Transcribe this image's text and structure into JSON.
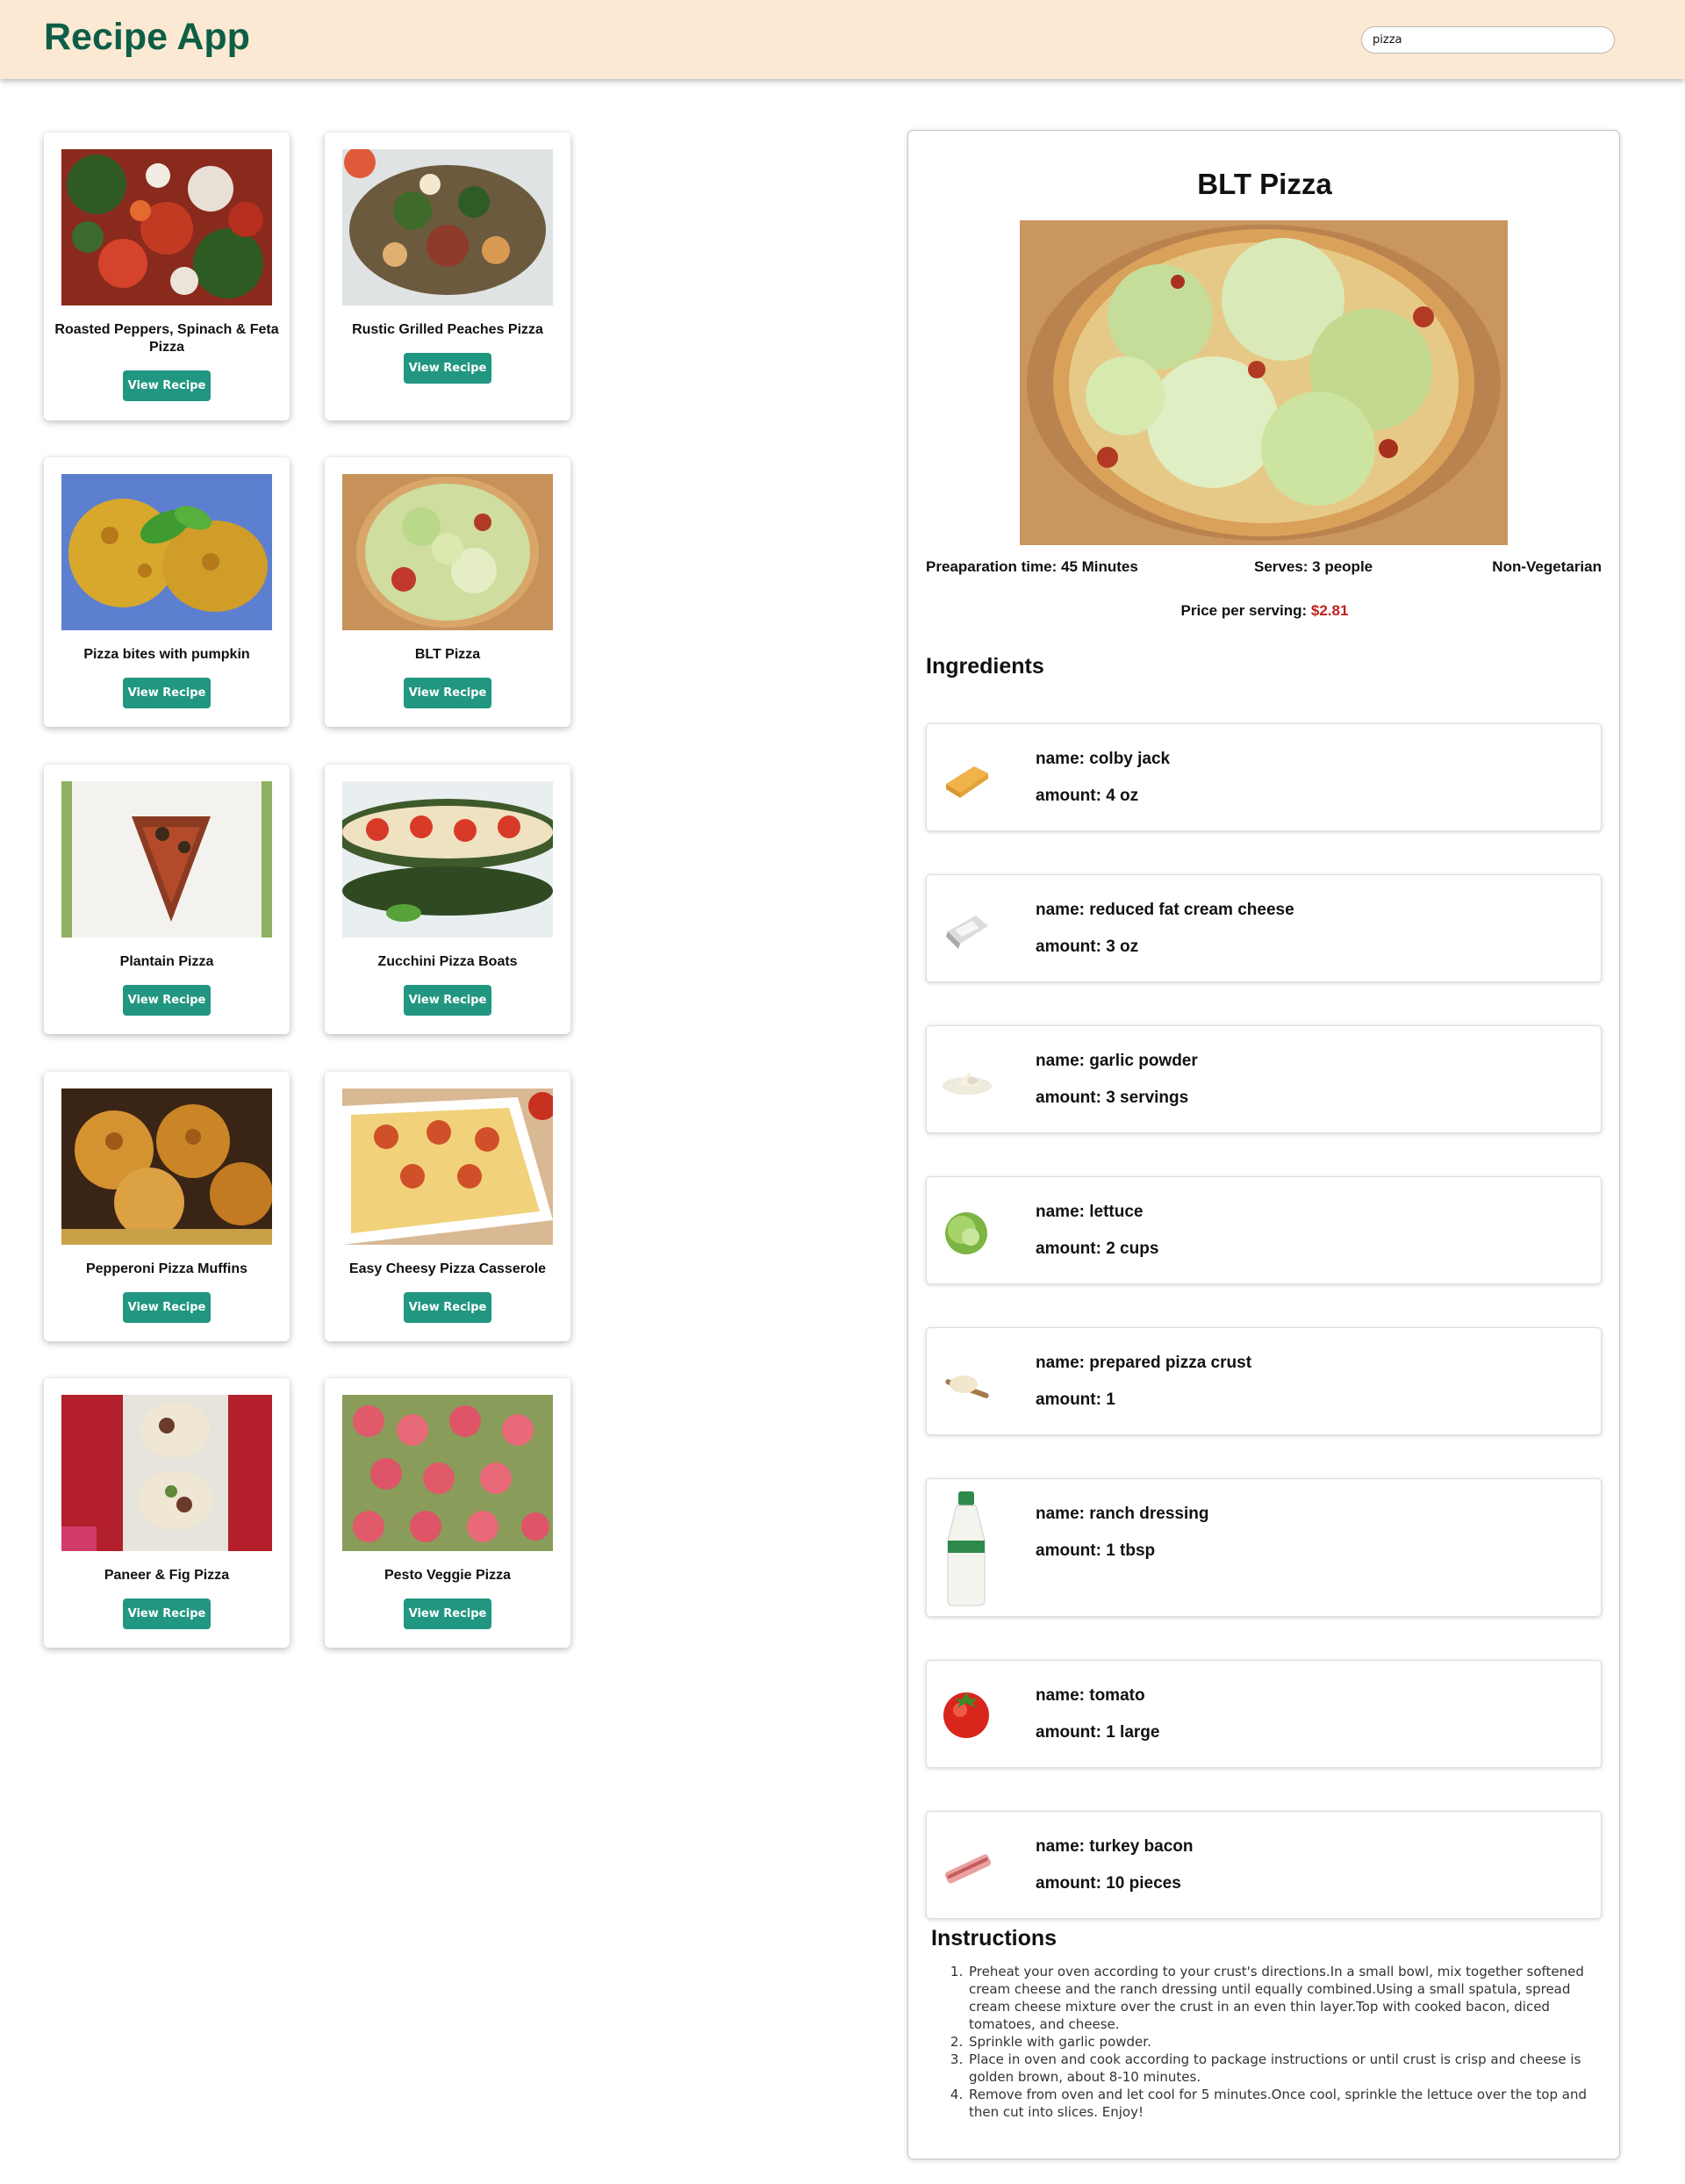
{
  "header": {
    "brand": "Recipe App",
    "search_value": "pizza"
  },
  "recipes": [
    {
      "title": "Roasted Peppers, Spinach & Feta Pizza",
      "button": "View Recipe"
    },
    {
      "title": "Rustic Grilled Peaches Pizza",
      "button": "View Recipe"
    },
    {
      "title": "Pizza bites with pumpkin",
      "button": "View Recipe"
    },
    {
      "title": "BLT Pizza",
      "button": "View Recipe"
    },
    {
      "title": "Plantain Pizza",
      "button": "View Recipe"
    },
    {
      "title": "Zucchini Pizza Boats",
      "button": "View Recipe"
    },
    {
      "title": "Pepperoni Pizza Muffins",
      "button": "View Recipe"
    },
    {
      "title": "Easy Cheesy Pizza Casserole",
      "button": "View Recipe"
    },
    {
      "title": "Paneer & Fig Pizza",
      "button": "View Recipe"
    },
    {
      "title": "Pesto Veggie Pizza",
      "button": "View Recipe"
    }
  ],
  "detail": {
    "title": "BLT Pizza",
    "prep_time": "Preaparation time: 45 Minutes",
    "serves": "Serves: 3 people",
    "diet": "Non-Vegetarian",
    "price_label": "Price per serving: ",
    "price_value": "$2.81",
    "ingredients_heading": "Ingredients",
    "ingredients": [
      {
        "name": "name: colby jack",
        "amount": "amount: 4 oz",
        "icon": "cheese-icon"
      },
      {
        "name": "name: reduced fat cream cheese",
        "amount": "amount: 3 oz",
        "icon": "cream-cheese-icon"
      },
      {
        "name": "name: garlic powder",
        "amount": "amount: 3 servings",
        "icon": "garlic-powder-icon"
      },
      {
        "name": "name: lettuce",
        "amount": "amount: 2 cups",
        "icon": "lettuce-icon"
      },
      {
        "name": "name: prepared pizza crust",
        "amount": "amount: 1",
        "icon": "dough-icon"
      },
      {
        "name": "name: ranch dressing",
        "amount": "amount: 1 tbsp",
        "icon": "dressing-bottle-icon"
      },
      {
        "name": "name: tomato",
        "amount": "amount: 1 large",
        "icon": "tomato-icon"
      },
      {
        "name": "name: turkey bacon",
        "amount": "amount: 10 pieces",
        "icon": "bacon-icon"
      }
    ],
    "instructions_heading": "Instructions",
    "instructions": [
      "Preheat your oven according to your crust's directions.In a small bowl, mix together softened cream cheese and the ranch dressing until equally combined.Using a small spatula, spread cream cheese mixture over the crust in an even thin layer.Top with cooked bacon, diced tomatoes, and cheese.",
      "Sprinkle with garlic powder.",
      "Place in oven and cook according to package instructions or until crust is crisp and cheese is golden brown, about 8-10 minutes.",
      "Remove from oven and let cool for 5 minutes.Once cool, sprinkle the lettuce over the top and then cut into slices. Enjoy!"
    ]
  },
  "colors": {
    "brand": "#0e5e46",
    "header_bg": "#fbe9d4",
    "button": "#219680",
    "price": "#c0211f"
  }
}
